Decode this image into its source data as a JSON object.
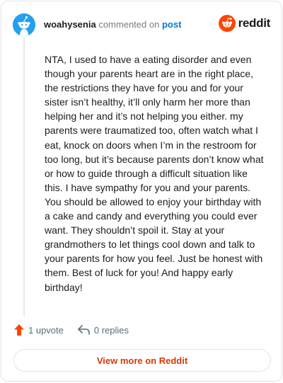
{
  "header": {
    "username": "woahysenia",
    "action_text": "commented on",
    "post_link_label": "post",
    "brand_name": "reddit"
  },
  "comment": {
    "body": "NTA, I used to have a eating disorder and even though your parents heart are in the right place, the restrictions they have for you and for your sister isn’t healthy, it’ll only harm her more than helping her and it’s not helping you either. my parents were traumatized too, often watch what I eat, knock on doors when I’m in the restroom for too long, but it’s because parents don’t know what or how to guide through a difficult situation like this. I have sympathy for you and your parents. You should be allowed to enjoy your birthday with a cake and candy and everything you could ever want. They shouldn’t spoil it. Stay at your grandmothers to let things cool down and talk to your parents for how you feel. Just be honest with them. Best of luck for you! And happy early birthday!"
  },
  "actions": {
    "upvotes": "1 upvote",
    "replies": "0 replies"
  },
  "footer": {
    "view_more_label": "View more on Reddit"
  },
  "colors": {
    "brand_orange": "#ff4500",
    "link_blue": "#0079d3",
    "avatar_blue": "#24a0ed",
    "view_more_text": "#d93a00",
    "muted_text": "#576f76"
  },
  "icons": {
    "avatar": "snoo-avatar-icon",
    "brand": "reddit-logo-icon",
    "upvote": "upvote-arrow-icon",
    "reply": "reply-arrow-icon"
  }
}
